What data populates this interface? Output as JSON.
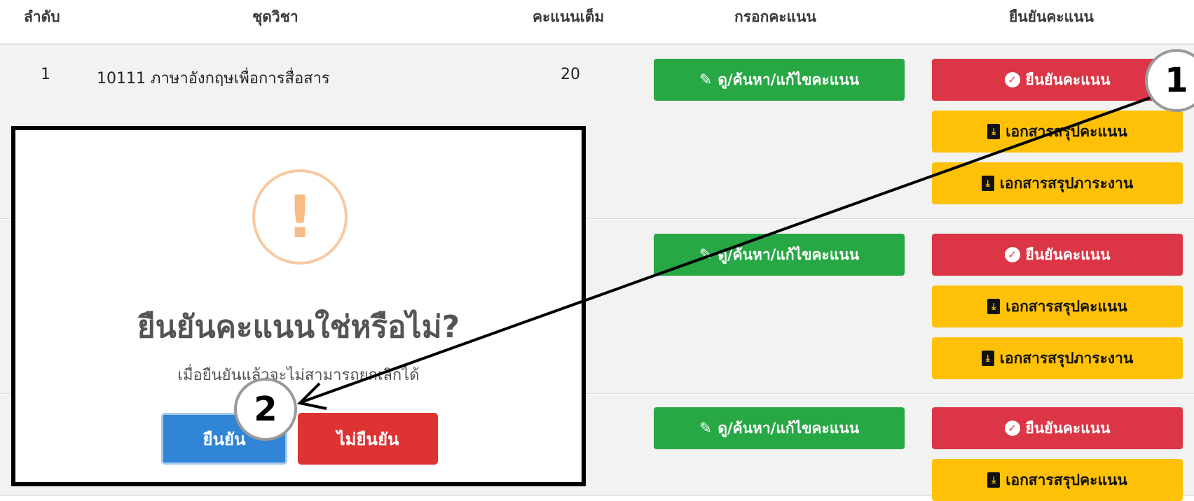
{
  "table": {
    "headers": [
      "ลำดับ",
      "ชุดวิชา",
      "คะแนนเต็ม",
      "กรอกคะแนน",
      "ยืนยันคะแนน"
    ],
    "rows": [
      {
        "index": "1",
        "course": "10111 ภาษาอังกฤษเพื่อการสื่อสาร",
        "full_score": "20"
      },
      {
        "index": "",
        "course": "",
        "full_score": ""
      },
      {
        "index": "",
        "course": "",
        "full_score": ""
      }
    ],
    "edit_label": "ดู/ค้นหา/แก้ไขคะแนน",
    "confirm_label": "ยืนยันคะแนน",
    "summary_score_doc": "เอกสารสรุปคะแนน",
    "summary_workload_doc": "เอกสารสรุปภาระงาน"
  },
  "modal": {
    "icon": "warning-icon",
    "title": "ยืนยันคะแนนใช่หรือไม่?",
    "text": "เมื่อยืนยันแล้วจะไม่สามารถยกเลิกได้",
    "confirm_button": "ยืนยัน",
    "cancel_button": "ไม่ยืนยัน"
  },
  "annotations": {
    "step1": "1",
    "step2": "2"
  },
  "colors": {
    "green": "#28a745",
    "red": "#dc3545",
    "yellow": "#ffc107",
    "blue": "#3085d6"
  }
}
